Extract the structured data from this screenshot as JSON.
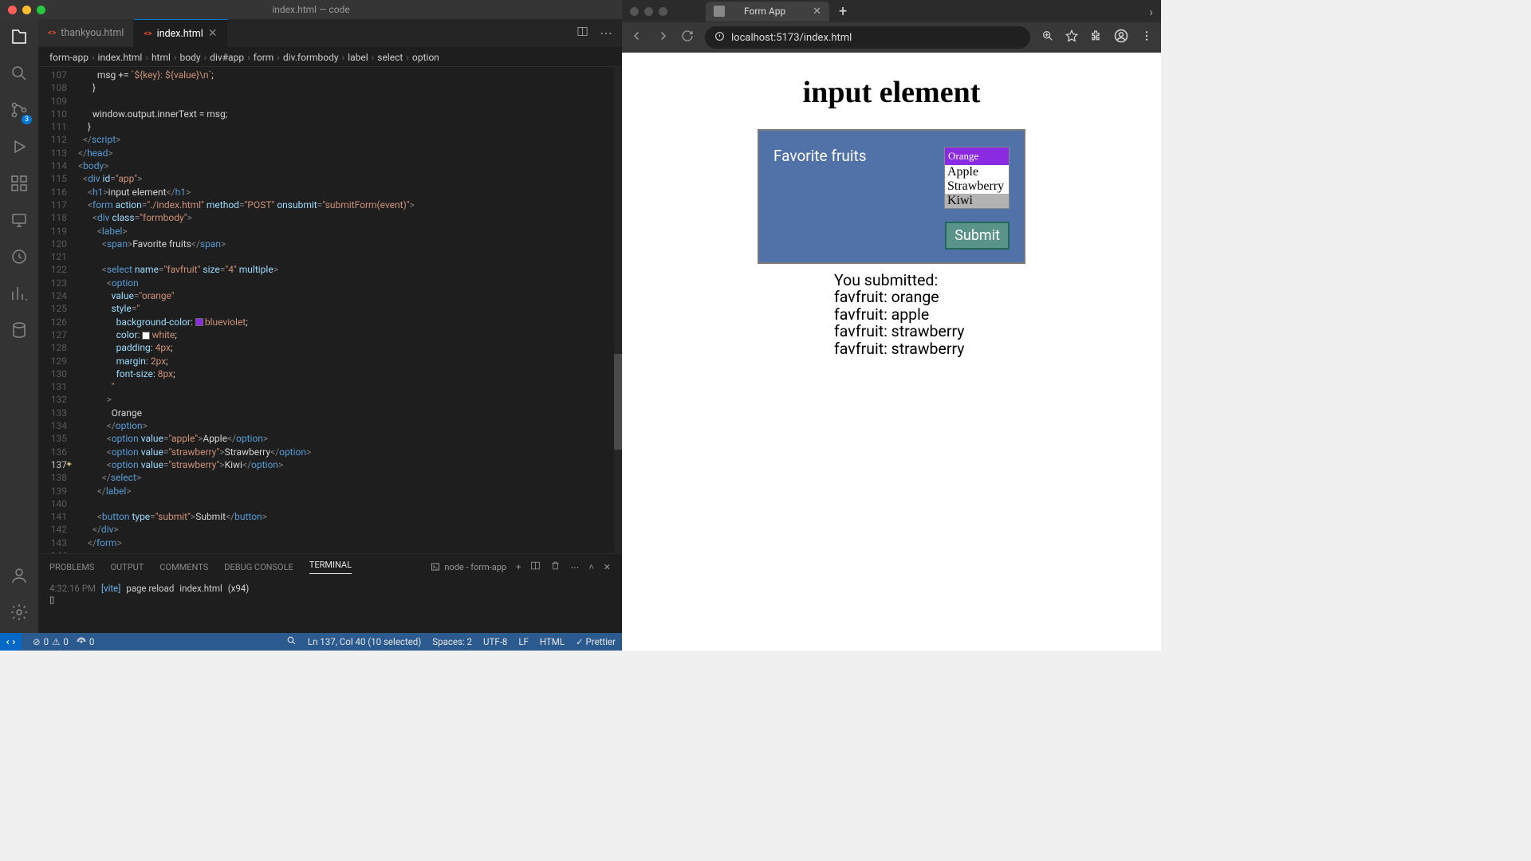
{
  "vscode": {
    "window_title": "index.html — code",
    "tabs": [
      {
        "label": "thankyou.html",
        "active": false
      },
      {
        "label": "index.html",
        "active": true
      }
    ],
    "breadcrumb": [
      "form-app",
      "index.html",
      "html",
      "body",
      "div#app",
      "form",
      "div.formbody",
      "label",
      "select",
      "option"
    ],
    "scm_badge": "3",
    "code_lines": [
      {
        "n": 107,
        "i": 8,
        "segs": [
          [
            "txt",
            "msg += "
          ],
          [
            "str",
            "`${key}: ${value}\\n`"
          ],
          [
            "txt",
            ";"
          ]
        ]
      },
      {
        "n": 108,
        "i": 6,
        "segs": [
          [
            "txt",
            "}"
          ]
        ]
      },
      {
        "n": 109,
        "i": 0,
        "segs": []
      },
      {
        "n": 110,
        "i": 6,
        "segs": [
          [
            "txt",
            "window.output.innerText = msg;"
          ]
        ]
      },
      {
        "n": 111,
        "i": 4,
        "segs": [
          [
            "txt",
            "}"
          ]
        ]
      },
      {
        "n": 112,
        "i": 2,
        "segs": [
          [
            "pn",
            "</"
          ],
          [
            "tag",
            "script"
          ],
          [
            "pn",
            ">"
          ]
        ]
      },
      {
        "n": 113,
        "i": 0,
        "segs": [
          [
            "pn",
            "</"
          ],
          [
            "tag",
            "head"
          ],
          [
            "pn",
            ">"
          ]
        ]
      },
      {
        "n": 114,
        "i": 0,
        "segs": [
          [
            "pn",
            "<"
          ],
          [
            "tag",
            "body"
          ],
          [
            "pn",
            ">"
          ]
        ]
      },
      {
        "n": 115,
        "i": 2,
        "segs": [
          [
            "pn",
            "<"
          ],
          [
            "tag",
            "div"
          ],
          [
            "txt",
            " "
          ],
          [
            "attr",
            "id"
          ],
          [
            "pn",
            "="
          ],
          [
            "str",
            "\"app\""
          ],
          [
            "pn",
            ">"
          ]
        ]
      },
      {
        "n": 116,
        "i": 4,
        "segs": [
          [
            "pn",
            "<"
          ],
          [
            "tag",
            "h1"
          ],
          [
            "pn",
            ">"
          ],
          [
            "txt",
            "input element"
          ],
          [
            "pn",
            "</"
          ],
          [
            "tag",
            "h1"
          ],
          [
            "pn",
            ">"
          ]
        ]
      },
      {
        "n": 117,
        "i": 4,
        "segs": [
          [
            "pn",
            "<"
          ],
          [
            "tag",
            "form"
          ],
          [
            "txt",
            " "
          ],
          [
            "attr",
            "action"
          ],
          [
            "pn",
            "="
          ],
          [
            "str",
            "\"./index.html\""
          ],
          [
            "txt",
            " "
          ],
          [
            "attr",
            "method"
          ],
          [
            "pn",
            "="
          ],
          [
            "str",
            "\"POST\""
          ],
          [
            "txt",
            " "
          ],
          [
            "attr",
            "onsubmit"
          ],
          [
            "pn",
            "="
          ],
          [
            "str",
            "\"submitForm(event)\""
          ],
          [
            "pn",
            ">"
          ]
        ]
      },
      {
        "n": 118,
        "i": 6,
        "segs": [
          [
            "pn",
            "<"
          ],
          [
            "tag",
            "div"
          ],
          [
            "txt",
            " "
          ],
          [
            "attr",
            "class"
          ],
          [
            "pn",
            "="
          ],
          [
            "str",
            "\"formbody\""
          ],
          [
            "pn",
            ">"
          ]
        ]
      },
      {
        "n": 119,
        "i": 8,
        "segs": [
          [
            "pn",
            "<"
          ],
          [
            "tag",
            "label"
          ],
          [
            "pn",
            ">"
          ]
        ]
      },
      {
        "n": 120,
        "i": 10,
        "segs": [
          [
            "pn",
            "<"
          ],
          [
            "tag",
            "span"
          ],
          [
            "pn",
            ">"
          ],
          [
            "txt",
            "Favorite fruits"
          ],
          [
            "pn",
            "</"
          ],
          [
            "tag",
            "span"
          ],
          [
            "pn",
            ">"
          ]
        ]
      },
      {
        "n": 121,
        "i": 0,
        "segs": []
      },
      {
        "n": 122,
        "i": 10,
        "segs": [
          [
            "pn",
            "<"
          ],
          [
            "tag",
            "select"
          ],
          [
            "txt",
            " "
          ],
          [
            "attr",
            "name"
          ],
          [
            "pn",
            "="
          ],
          [
            "str",
            "\"favfruit\""
          ],
          [
            "txt",
            " "
          ],
          [
            "attr",
            "size"
          ],
          [
            "pn",
            "="
          ],
          [
            "str",
            "\"4\""
          ],
          [
            "txt",
            " "
          ],
          [
            "attr",
            "multiple"
          ],
          [
            "pn",
            ">"
          ]
        ]
      },
      {
        "n": 123,
        "i": 12,
        "segs": [
          [
            "pn",
            "<"
          ],
          [
            "tag",
            "option"
          ]
        ]
      },
      {
        "n": 124,
        "i": 14,
        "segs": [
          [
            "attr",
            "value"
          ],
          [
            "pn",
            "="
          ],
          [
            "str",
            "\"orange\""
          ]
        ]
      },
      {
        "n": 125,
        "i": 14,
        "segs": [
          [
            "attr",
            "style"
          ],
          [
            "pn",
            "="
          ],
          [
            "str",
            "\""
          ]
        ]
      },
      {
        "n": 126,
        "i": 16,
        "segs": [
          [
            "prop",
            "background-color"
          ],
          [
            "txt",
            ": "
          ],
          [
            "swatch",
            "blue"
          ],
          [
            "val",
            "blueviolet"
          ],
          [
            "txt",
            ";"
          ]
        ]
      },
      {
        "n": 127,
        "i": 16,
        "segs": [
          [
            "prop",
            "color"
          ],
          [
            "txt",
            ": "
          ],
          [
            "swatch",
            "white"
          ],
          [
            "val",
            "white"
          ],
          [
            "txt",
            ";"
          ]
        ]
      },
      {
        "n": 128,
        "i": 16,
        "segs": [
          [
            "prop",
            "padding"
          ],
          [
            "txt",
            ": "
          ],
          [
            "val",
            "4px"
          ],
          [
            "txt",
            ";"
          ]
        ]
      },
      {
        "n": 129,
        "i": 16,
        "segs": [
          [
            "prop",
            "margin"
          ],
          [
            "txt",
            ": "
          ],
          [
            "val",
            "2px"
          ],
          [
            "txt",
            ";"
          ]
        ]
      },
      {
        "n": 130,
        "i": 16,
        "segs": [
          [
            "prop",
            "font-size"
          ],
          [
            "txt",
            ": "
          ],
          [
            "val",
            "8px"
          ],
          [
            "txt",
            ";"
          ]
        ]
      },
      {
        "n": 131,
        "i": 14,
        "segs": [
          [
            "str",
            "\""
          ]
        ]
      },
      {
        "n": 132,
        "i": 12,
        "segs": [
          [
            "pn",
            ">"
          ]
        ]
      },
      {
        "n": 133,
        "i": 14,
        "segs": [
          [
            "txt",
            "Orange"
          ]
        ]
      },
      {
        "n": 134,
        "i": 12,
        "segs": [
          [
            "pn",
            "</"
          ],
          [
            "tag",
            "option"
          ],
          [
            "pn",
            ">"
          ]
        ]
      },
      {
        "n": 135,
        "i": 12,
        "segs": [
          [
            "pn",
            "<"
          ],
          [
            "tag",
            "option"
          ],
          [
            "txt",
            " "
          ],
          [
            "attr",
            "value"
          ],
          [
            "pn",
            "="
          ],
          [
            "str",
            "\"apple\""
          ],
          [
            "pn",
            ">"
          ],
          [
            "txt",
            "Apple"
          ],
          [
            "pn",
            "</"
          ],
          [
            "tag",
            "option"
          ],
          [
            "pn",
            ">"
          ]
        ]
      },
      {
        "n": 136,
        "i": 12,
        "segs": [
          [
            "pn",
            "<"
          ],
          [
            "tag",
            "option"
          ],
          [
            "txt",
            " "
          ],
          [
            "attr",
            "value"
          ],
          [
            "pn",
            "="
          ],
          [
            "str",
            "\"strawberry\""
          ],
          [
            "pn",
            ">"
          ],
          [
            "txt",
            "Strawberry"
          ],
          [
            "pn",
            "</"
          ],
          [
            "tag",
            "option"
          ],
          [
            "pn",
            ">"
          ]
        ]
      },
      {
        "n": 137,
        "i": 12,
        "hl": true,
        "segs": [
          [
            "pn",
            "<"
          ],
          [
            "tag",
            "option"
          ],
          [
            "txt",
            " "
          ],
          [
            "attr",
            "value"
          ],
          [
            "pn",
            "="
          ],
          [
            "str",
            "\"strawberry\""
          ],
          [
            "pn",
            ">"
          ],
          [
            "txt",
            "Kiwi"
          ],
          [
            "pn",
            "</"
          ],
          [
            "tag",
            "option"
          ],
          [
            "pn",
            ">"
          ]
        ]
      },
      {
        "n": 138,
        "i": 10,
        "segs": [
          [
            "pn",
            "</"
          ],
          [
            "tag",
            "select"
          ],
          [
            "pn",
            ">"
          ]
        ]
      },
      {
        "n": 139,
        "i": 8,
        "segs": [
          [
            "pn",
            "</"
          ],
          [
            "tag",
            "label"
          ],
          [
            "pn",
            ">"
          ]
        ]
      },
      {
        "n": 140,
        "i": 0,
        "segs": []
      },
      {
        "n": 141,
        "i": 8,
        "segs": [
          [
            "pn",
            "<"
          ],
          [
            "tag",
            "button"
          ],
          [
            "txt",
            " "
          ],
          [
            "attr",
            "type"
          ],
          [
            "pn",
            "="
          ],
          [
            "str",
            "\"submit\""
          ],
          [
            "pn",
            ">"
          ],
          [
            "txt",
            "Submit"
          ],
          [
            "pn",
            "</"
          ],
          [
            "tag",
            "button"
          ],
          [
            "pn",
            ">"
          ]
        ]
      },
      {
        "n": 142,
        "i": 6,
        "segs": [
          [
            "pn",
            "</"
          ],
          [
            "tag",
            "div"
          ],
          [
            "pn",
            ">"
          ]
        ]
      },
      {
        "n": 143,
        "i": 4,
        "segs": [
          [
            "pn",
            "</"
          ],
          [
            "tag",
            "form"
          ],
          [
            "pn",
            ">"
          ]
        ]
      },
      {
        "n": 144,
        "i": 0,
        "segs": []
      }
    ],
    "panel": {
      "tabs": [
        "PROBLEMS",
        "OUTPUT",
        "COMMENTS",
        "DEBUG CONSOLE",
        "TERMINAL"
      ],
      "active_tab": "TERMINAL",
      "task": "node - form-app",
      "term_time": "4:32:16 PM",
      "term_tag": "[vite]",
      "term_msg": "page reload",
      "term_file": "index.html",
      "term_count": "(x94)"
    },
    "status": {
      "errors": "0",
      "warnings": "0",
      "ports": "0",
      "cursor": "Ln 137, Col 40 (10 selected)",
      "spaces": "Spaces: 2",
      "encoding": "UTF-8",
      "eol": "LF",
      "lang": "HTML",
      "prettier": "Prettier"
    }
  },
  "browser": {
    "tab_title": "Form App",
    "url": "localhost:5173/index.html",
    "page": {
      "heading": "input element",
      "label": "Favorite fruits",
      "options": [
        {
          "text": "Orange",
          "cls": "orange"
        },
        {
          "text": "Apple",
          "cls": ""
        },
        {
          "text": "Strawberry",
          "cls": ""
        },
        {
          "text": "Kiwi",
          "cls": "sel"
        }
      ],
      "submit": "Submit",
      "output": [
        "You submitted:",
        "favfruit: orange",
        "favfruit: apple",
        "favfruit: strawberry",
        "favfruit: strawberry"
      ]
    }
  }
}
